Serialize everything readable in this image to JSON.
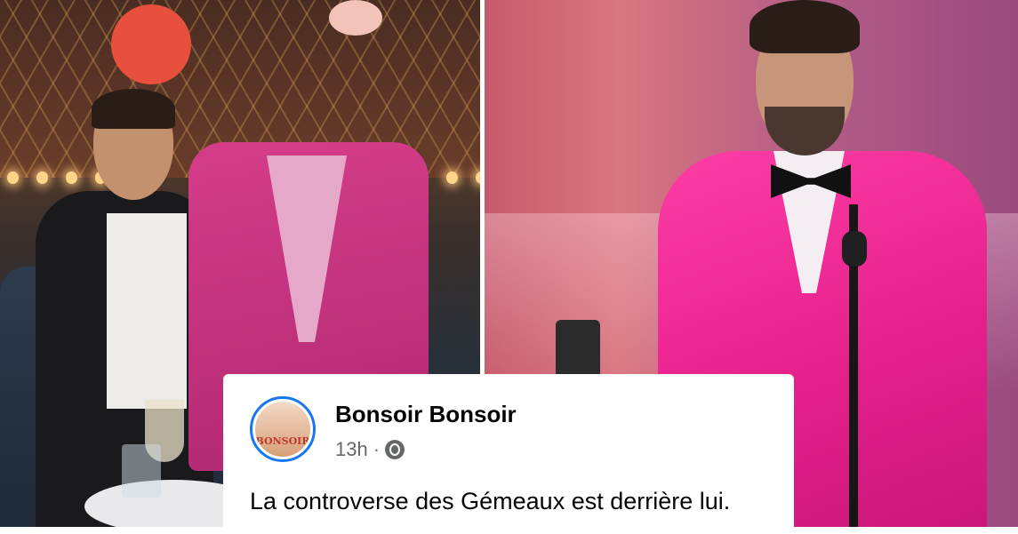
{
  "post": {
    "page_name": "Bonsoir Bonsoir",
    "time": "13h",
    "separator": "·",
    "privacy_icon": "globe-icon",
    "avatar_text": "BONSOIR",
    "text_line1": "La controverse des Gémeaux est derrière lui."
  },
  "colors": {
    "facebook_blue": "#1877f2",
    "jacket_pink": "#e31f8a"
  }
}
